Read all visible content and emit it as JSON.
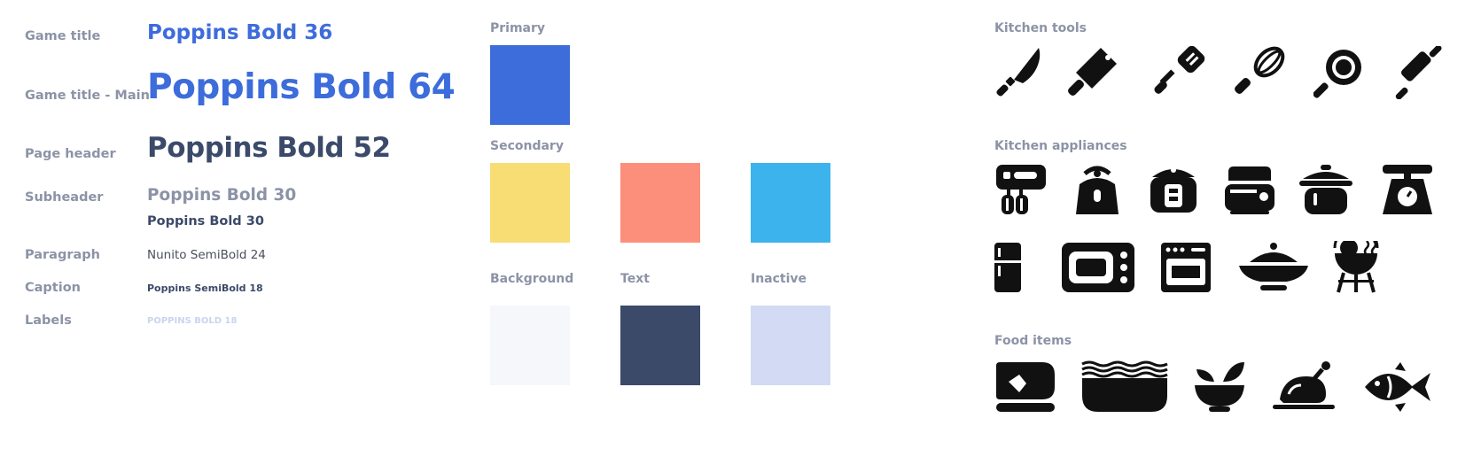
{
  "typography": {
    "rows": [
      {
        "label": "Game title",
        "sample": "Poppins Bold 36",
        "color": "#3d6cdb"
      },
      {
        "label": "Game title - Main",
        "sample": "Poppins Bold 64",
        "color": "#3d6cdb"
      },
      {
        "label": "Page header",
        "sample": "Poppins Bold 52",
        "color": "#3b4a69"
      },
      {
        "label": "Subheader",
        "sample": "Poppins Bold 30",
        "sample2": "Poppins Bold 30",
        "color": "#8c93a6",
        "color2": "#3b4a69"
      },
      {
        "label": "Paragraph",
        "sample": "Nunito SemiBold 24",
        "color": "#4a4f5c"
      },
      {
        "label": "Caption",
        "sample": "Poppins SemiBold 18",
        "color": "#3b4a69"
      },
      {
        "label": "Labels",
        "sample": "POPPINS BOLD 18",
        "color": "#cad4ef"
      }
    ]
  },
  "colors": {
    "primary": {
      "title": "Primary",
      "swatches": [
        "#3d6cdb"
      ]
    },
    "secondary": {
      "title": "Secondary",
      "swatches": [
        "#f7dd74",
        "#fc8f7b",
        "#3db3ee"
      ]
    },
    "neutrals": [
      {
        "title": "Background",
        "color": "#f6f7fb"
      },
      {
        "title": "Text",
        "color": "#3b4a69"
      },
      {
        "title": "Inactive",
        "color": "#d2dbf3"
      }
    ]
  },
  "icons": {
    "kitchen_tools": {
      "title": "Kitchen tools",
      "items": [
        "knife-icon",
        "cleaver-icon",
        "spatula-icon",
        "whisk-icon",
        "frying-pan-icon",
        "rolling-pin-icon"
      ]
    },
    "kitchen_appliances": {
      "title": "Kitchen appliances",
      "items": [
        "hand-mixer-icon",
        "kettle-icon",
        "rice-cooker-icon",
        "toaster-icon",
        "cooking-pot-icon",
        "kitchen-scale-icon",
        "refrigerator-icon",
        "microwave-icon",
        "oven-icon",
        "wok-icon",
        "grill-icon"
      ]
    },
    "food_items": {
      "title": "Food items",
      "items": [
        "steak-icon",
        "noodles-icon",
        "salad-bowl-icon",
        "roast-chicken-icon",
        "fish-icon"
      ]
    }
  }
}
